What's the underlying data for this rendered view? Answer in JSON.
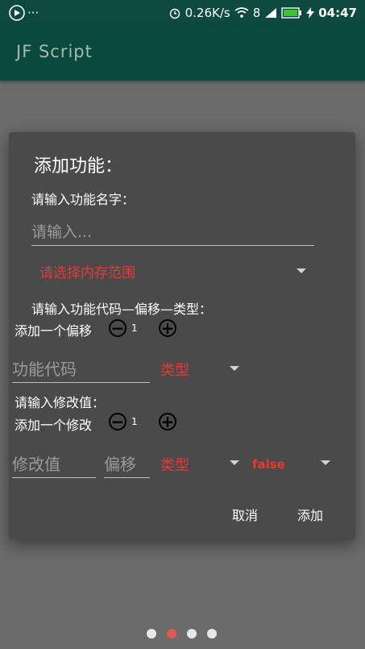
{
  "status_bar": {
    "speed": "0.26K/s",
    "battery": "8",
    "time": "04:47"
  },
  "app_bar": {
    "title": "JF Script"
  },
  "dialog": {
    "title": "添加功能：",
    "name_label": "请输入功能名字：",
    "name_placeholder": "请输入...",
    "memory_range_spinner": "请选择内存范围",
    "code_label": "请输入功能代码—偏移—类型：",
    "add_offset_label": "添加一个偏移",
    "offset_count": "1",
    "code_placeholder": "功能代码",
    "code_type_spinner": "类型",
    "modify_label": "请输入修改值：",
    "add_modify_label": "添加一个修改",
    "modify_count": "1",
    "modify_value_placeholder": "修改值",
    "modify_offset_placeholder": "偏移",
    "modify_type_spinner": "类型",
    "freeze_spinner": "false",
    "cancel_button": "取消",
    "add_button": "添加"
  },
  "pager": {
    "pages": 4,
    "active_index": 1
  }
}
